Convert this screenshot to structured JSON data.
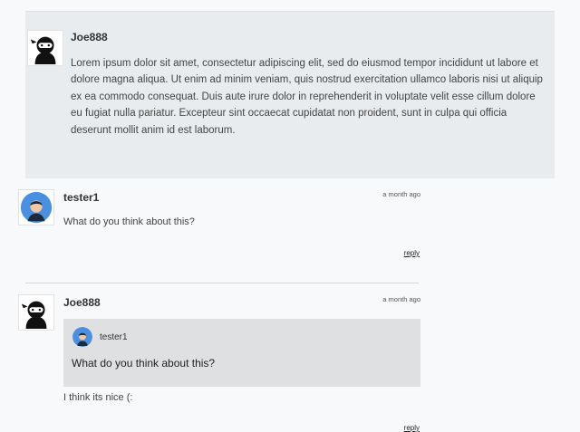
{
  "post": {
    "author": "Joe888",
    "avatar_icon": "ninja-avatar-icon",
    "body": "Lorem ipsum dolor sit amet, consectetur adipiscing elit, sed do eiusmod tempor incididunt ut labore et dolore magna aliqua. Ut enim ad minim veniam, quis nostrud exercitation ullamco laboris nisi ut aliquip ex ea commodo consequat. Duis aute irure dolor in reprehenderit in voluptate velit esse cillum dolore eu fugiat nulla pariatur. Excepteur sint occaecat cupidatat non proident, sunt in culpa qui officia deserunt mollit anim id est laborum."
  },
  "comments": [
    {
      "author": "tester1",
      "avatar_icon": "user-avatar-icon",
      "time": "a month ago",
      "text": "What do you think about this?",
      "reply_label": "reply"
    },
    {
      "author": "Joe888",
      "avatar_icon": "ninja-avatar-icon",
      "time": "a month ago",
      "quote": {
        "author": "tester1",
        "avatar_icon": "user-avatar-icon",
        "text": "What do you think about this?"
      },
      "text": "I think its nice (:",
      "reply_label": "reply"
    }
  ],
  "colors": {
    "background": "#f8f9fa",
    "post_background": "#e9ecef",
    "quote_background": "#dfe0e2",
    "user_avatar_blue": "#4a90e2"
  }
}
